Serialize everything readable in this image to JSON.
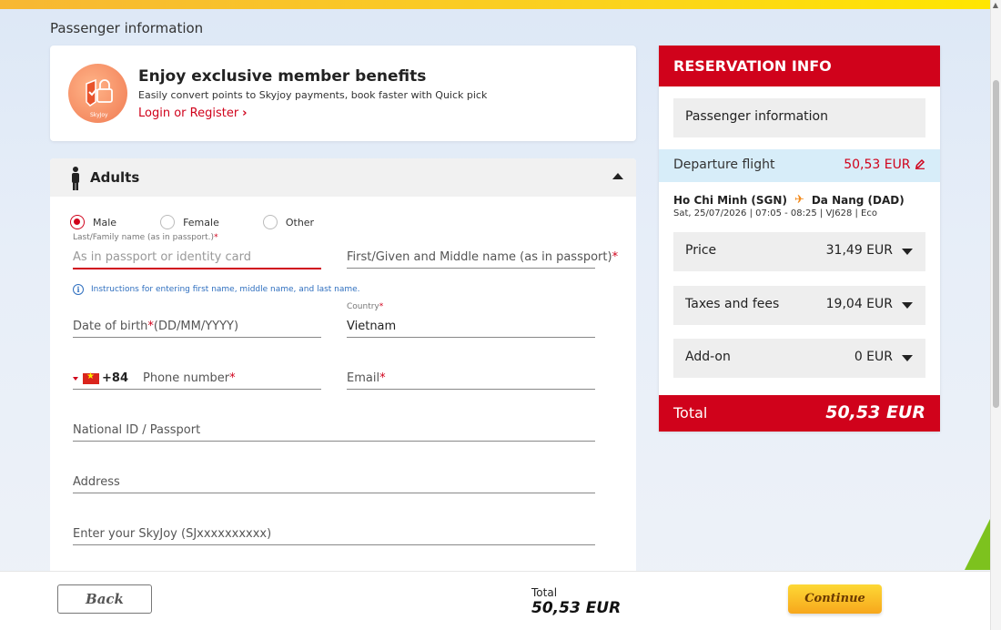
{
  "page": {
    "section_title": "Passenger information"
  },
  "member": {
    "title": "Enjoy exclusive member benefits",
    "subtitle": "Easily convert points to Skyjoy payments, book faster with Quick pick",
    "link": "Login or Register",
    "badge_text": "SkyJoy"
  },
  "passenger": {
    "header": "Adults",
    "gender_options": [
      "Male",
      "Female",
      "Other"
    ],
    "gender_selected": "Male",
    "last_name_label": "Last/Family name (as in passport.)",
    "last_name_placeholder": "As in passport or identity card",
    "first_name_placeholder": "First/Given and Middle name (as in passport)",
    "instructions": "Instructions for entering first name, middle name, and last name.",
    "dob_placeholder_a": "Date of birth",
    "dob_placeholder_b": "(DD/MM/YYYY)",
    "country_label": "Country",
    "country_value": "Vietnam",
    "phone_code": "+84",
    "phone_placeholder": "Phone number",
    "email_placeholder": "Email",
    "national_id_placeholder": "National ID / Passport",
    "address_placeholder": "Address",
    "skyjoy_placeholder": "Enter your SkyJoy (SJxxxxxxxxxx)",
    "required_mark": "*"
  },
  "reservation": {
    "title": "RESERVATION INFO",
    "passenger_info": "Passenger information",
    "departure_label": "Departure flight",
    "departure_amount": "50,53 EUR",
    "origin": "Ho Chi Minh (SGN)",
    "destination": "Da Nang (DAD)",
    "flight_details": "Sat, 25/07/2026 | 07:05 - 08:25 | VJ628 | Eco",
    "rows": [
      {
        "label": "Price",
        "value": "31,49 EUR"
      },
      {
        "label": "Taxes and fees",
        "value": "19,04 EUR"
      },
      {
        "label": "Add-on",
        "value": "0 EUR"
      }
    ],
    "total_label": "Total",
    "total_amount": "50,53 EUR"
  },
  "footer": {
    "back": "Back",
    "total_label": "Total",
    "total_amount": "50,53 EUR",
    "continue": "Continue"
  },
  "colors": {
    "brand_red": "#d0021b",
    "accent_yellow": "#fbd21e",
    "highlight_blue": "#d7edf9"
  }
}
